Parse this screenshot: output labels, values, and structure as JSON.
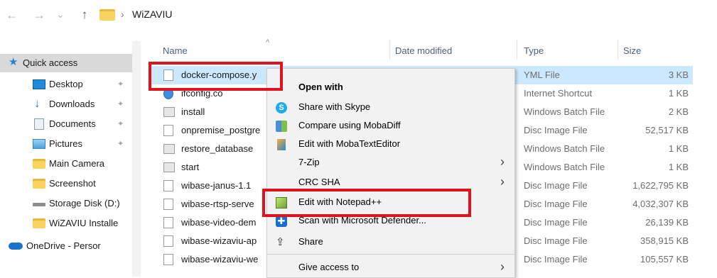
{
  "address_bar": {
    "back": "←",
    "forward": "→",
    "recent": "⌄",
    "up": "↑",
    "separator": "›",
    "crumb": "WiZAVIU"
  },
  "sidebar": {
    "scroll_up": "^",
    "items": [
      {
        "label": "Quick access",
        "icon": "star-icon",
        "color": "#2a7fd4",
        "selected": true
      },
      {
        "label": "Desktop",
        "icon": "desktop-icon",
        "color": "#1f8ad8",
        "pinned": true
      },
      {
        "label": "Downloads",
        "icon": "download-icon",
        "color": "#2a7fd4",
        "pinned": true
      },
      {
        "label": "Documents",
        "icon": "document-icon",
        "color": "#8a9bb0",
        "pinned": true
      },
      {
        "label": "Pictures",
        "icon": "pictures-icon",
        "color": "#4aa3df",
        "pinned": true
      },
      {
        "label": "Main Camera",
        "icon": "folder-icon",
        "color": "#f8d35e"
      },
      {
        "label": "Screenshot",
        "icon": "folder-icon",
        "color": "#f8d35e"
      },
      {
        "label": "Storage Disk (D:)",
        "icon": "drive-icon",
        "color": "#8c8c8c"
      },
      {
        "label": "WiZAVIU Installe",
        "icon": "folder-icon",
        "color": "#f8d35e"
      },
      {
        "label": "OneDrive - Persor",
        "icon": "cloud-icon",
        "color": "#1a73c9"
      }
    ]
  },
  "columns": {
    "sort_indicator": "^",
    "name": "Name",
    "date": "Date modified",
    "type": "Type",
    "size": "Size"
  },
  "files": [
    {
      "name": "docker-compose.y",
      "type": "YML File",
      "size": "3 KB",
      "selected": true
    },
    {
      "name": "ifconfig.co",
      "type": "Internet Shortcut",
      "size": "1 KB"
    },
    {
      "name": "install",
      "type": "Windows Batch File",
      "size": "2 KB"
    },
    {
      "name": "onpremise_postgre",
      "type": "Disc Image File",
      "size": "52,517 KB"
    },
    {
      "name": "restore_database",
      "type": "Windows Batch File",
      "size": "1 KB"
    },
    {
      "name": "start",
      "type": "Windows Batch File",
      "size": "1 KB"
    },
    {
      "name": "wibase-janus-1.1",
      "type": "Disc Image File",
      "size": "1,622,795 KB"
    },
    {
      "name": "wibase-rtsp-serve",
      "type": "Disc Image File",
      "size": "4,032,307 KB"
    },
    {
      "name": "wibase-video-dem",
      "type": "Disc Image File",
      "size": "26,139 KB"
    },
    {
      "name": "wibase-wizaviu-ap",
      "type": "Disc Image File",
      "size": "358,915 KB"
    },
    {
      "name": "wibase-wizaviu-we",
      "type": "Disc Image File",
      "size": "105,557 KB"
    }
  ],
  "context_menu": {
    "open_with": "Open with",
    "share_skype": "Share with Skype",
    "compare_moba": "Compare using MobaDiff",
    "edit_moba": "Edit with MobaTextEditor",
    "zip": "7-Zip",
    "crc": "CRC SHA",
    "notepadpp": "Edit with Notepad++",
    "defender": "Scan with Microsoft Defender...",
    "share": "Share",
    "give_access": "Give access to",
    "submenu_arrow": "›"
  },
  "highlight_color": "#e0121b"
}
